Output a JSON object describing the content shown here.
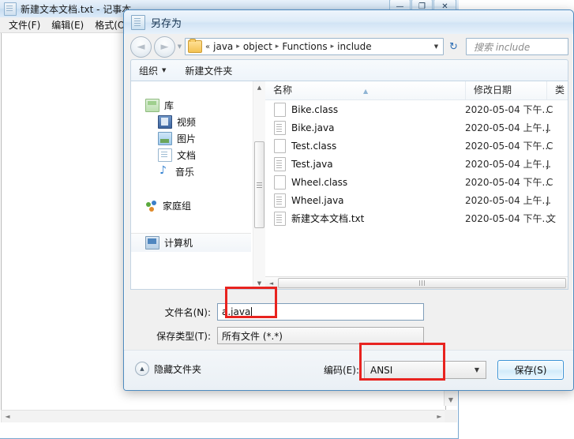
{
  "notepad": {
    "title": "新建文本文档.txt - 记事本",
    "icon": "notepad-icon",
    "menus": [
      {
        "label": "文件(F)"
      },
      {
        "label": "编辑(E)"
      },
      {
        "label": "格式(O)"
      }
    ],
    "window_buttons": [
      {
        "name": "minimize",
        "glyph": "—"
      },
      {
        "name": "maximize",
        "glyph": "❐"
      },
      {
        "name": "close",
        "glyph": "✕"
      }
    ],
    "scroll_up_glyph": "▲",
    "scroll_down_glyph": "▼",
    "scroll_left_glyph": "◄",
    "scroll_right_glyph": "►"
  },
  "dialog": {
    "title": "另存为",
    "nav": {
      "back_glyph": "◄",
      "forward_glyph": "►",
      "history_caret": "▼",
      "refresh_glyph": "↻"
    },
    "address": {
      "overflow_chevron": "«",
      "crumbs": [
        "java",
        "object",
        "Functions",
        "include"
      ],
      "separator": "▸",
      "dropdown_caret": "▼"
    },
    "search": {
      "placeholder": "搜索 include"
    },
    "toolbar": {
      "organize_label": "组织",
      "organize_caret": "▼",
      "new_folder_label": "新建文件夹"
    },
    "navpane": {
      "items": [
        {
          "label": "库",
          "icon": "library-icon",
          "level": 0
        },
        {
          "label": "视频",
          "icon": "video-icon",
          "level": 1
        },
        {
          "label": "图片",
          "icon": "pictures-icon",
          "level": 1
        },
        {
          "label": "文档",
          "icon": "documents-icon",
          "level": 1
        },
        {
          "label": "音乐",
          "icon": "music-icon",
          "level": 1
        },
        {
          "label": "家庭组",
          "icon": "homegroup-icon",
          "level": 0
        },
        {
          "label": "计算机",
          "icon": "computer-icon",
          "level": 0
        }
      ],
      "scroll_up_glyph": "▲",
      "scroll_down_glyph": "▼"
    },
    "filelist": {
      "columns": [
        "名称",
        "修改日期",
        "类"
      ],
      "sort_caret": "▲",
      "rows": [
        {
          "name": "Bike.class",
          "date": "2020-05-04 下午...",
          "type": "C",
          "icon": "blank-file-icon"
        },
        {
          "name": "Bike.java",
          "date": "2020-05-04 上午...",
          "type": "J",
          "icon": "text-file-icon"
        },
        {
          "name": "Test.class",
          "date": "2020-05-04 下午...",
          "type": "C",
          "icon": "blank-file-icon"
        },
        {
          "name": "Test.java",
          "date": "2020-05-04 上午...",
          "type": "J",
          "icon": "text-file-icon"
        },
        {
          "name": "Wheel.class",
          "date": "2020-05-04 下午...",
          "type": "C",
          "icon": "blank-file-icon"
        },
        {
          "name": "Wheel.java",
          "date": "2020-05-04 上午...",
          "type": "J",
          "icon": "text-file-icon"
        },
        {
          "name": "新建文本文档.txt",
          "date": "2020-05-04 下午...",
          "type": "文",
          "icon": "text-file-icon"
        }
      ],
      "hscroll_left_glyph": "◄"
    },
    "form": {
      "filename_label": "文件名(N):",
      "filename_value": "a.java",
      "filetype_label": "保存类型(T):",
      "filetype_value": "所有文件  (*.*)"
    },
    "bottom": {
      "hide_folders_label": "隐藏文件夹",
      "hide_folders_caret": "▲",
      "encoding_label": "编码(E):",
      "encoding_value": "ANSI",
      "encoding_caret": "▼",
      "save_label": "保存(S)"
    }
  },
  "annotations": {
    "color": "#e8231f",
    "boxes": [
      "filename-field-highlight",
      "encoding-dropdown-highlight"
    ]
  }
}
